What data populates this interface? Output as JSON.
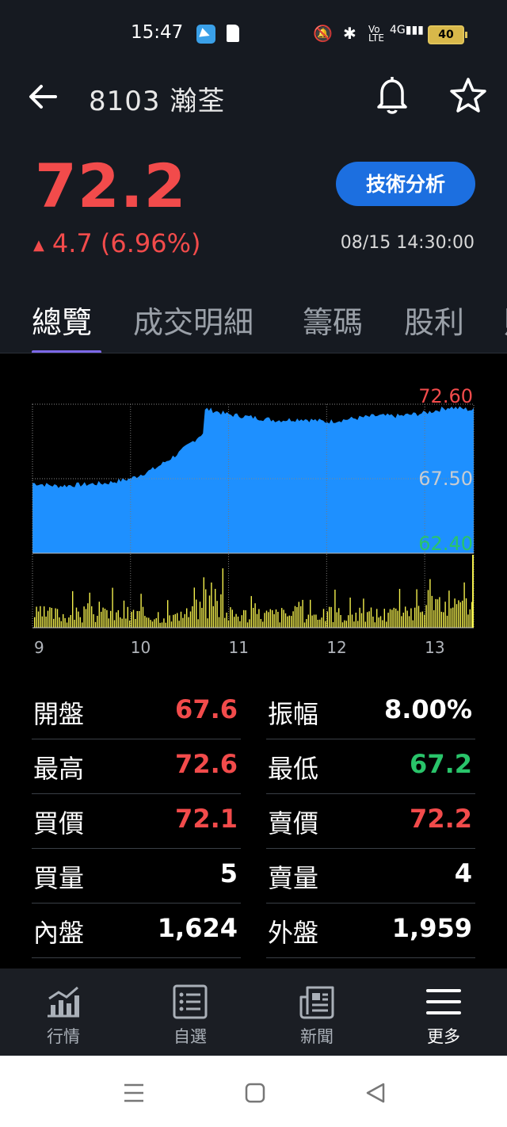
{
  "status_bar": {
    "time": "15:47",
    "battery": "40",
    "network": "4G"
  },
  "header": {
    "title": "8103 瀚荃"
  },
  "quote": {
    "price": "72.2",
    "change": "4.7 (6.96%)",
    "datetime": "08/15 14:30:00",
    "analysis_button": "技術分析"
  },
  "tabs": [
    "總覽",
    "成交明細",
    "籌碼",
    "股利",
    "財"
  ],
  "chart_data": {
    "type": "area",
    "y_labels": [
      "72.60",
      "67.50",
      "62.40"
    ],
    "ylim": [
      62.4,
      72.6
    ],
    "x_labels": [
      "9",
      "10",
      "11",
      "12",
      "13"
    ],
    "x": [
      9.0,
      9.25,
      9.5,
      9.75,
      10.0,
      10.25,
      10.5,
      10.75,
      10.76,
      11.0,
      11.25,
      11.5,
      11.75,
      12.0,
      12.25,
      12.5,
      12.75,
      13.0,
      13.25,
      13.5
    ],
    "price": [
      67.2,
      67.0,
      67.1,
      67.2,
      67.5,
      68.2,
      69.3,
      70.7,
      72.3,
      71.9,
      71.7,
      71.5,
      71.6,
      71.4,
      71.6,
      71.8,
      71.8,
      72.0,
      72.4,
      72.2
    ],
    "volume_series": "volume",
    "colors": {
      "area": "#1e90ff",
      "volume": "#f2ee4c",
      "high": "#f24b4b",
      "mid": "#c8ccd2",
      "low": "#29c46a"
    }
  },
  "stats": {
    "open_label": "開盤",
    "open": "67.6",
    "amp_label": "振幅",
    "amp": "8.00%",
    "high_label": "最高",
    "high": "72.6",
    "low_label": "最低",
    "low": "67.2",
    "bid_label": "買價",
    "bid": "72.1",
    "ask_label": "賣價",
    "ask": "72.2",
    "bidvol_label": "買量",
    "bidvol": "5",
    "askvol_label": "賣量",
    "askvol": "4",
    "inner_label": "內盤",
    "inner": "1,624",
    "outer_label": "外盤",
    "outer": "1,959"
  },
  "bottom_nav": [
    "行情",
    "自選",
    "新聞",
    "更多"
  ]
}
